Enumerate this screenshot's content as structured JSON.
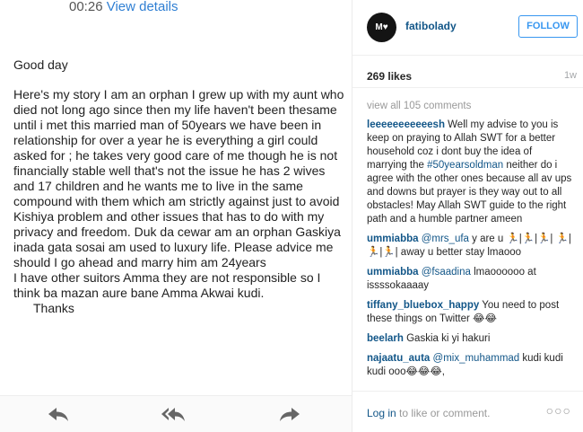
{
  "email": {
    "time": "00:26",
    "view_details": "View details",
    "greeting": "Good day",
    "body": "Here's my story I am an orphan I grew up with my aunt who died not long ago since then my life haven't been thesame until i met this married man of 50years we have been in relationship for over a year he is everything a girl could asked for ; he takes very good care of me though he is not financially stable well that's not the issue he has 2 wives and 17 children and he wants me to live in the same compound with them which am strictly against just to avoid Kishiya problem and other issues that has to do with my privacy and freedom. Duk da cewar am an orphan Gaskiya inada gata sosai am used to luxury life. Please advice me should I go ahead and marry him am 24years",
    "body2": "I have other suitors Amma they are not responsible so I think ba mazan aure bane Amma Akwai kudi.",
    "signoff": "Thanks",
    "footer_icons": [
      "reply-icon",
      "reply-all-icon",
      "forward-icon"
    ]
  },
  "instagram": {
    "avatar_text": "M♥",
    "username": "fatibolady",
    "follow_label": "FOLLOW",
    "likes": "269 likes",
    "age": "1w",
    "view_all": "view all 105 comments",
    "comments": [
      {
        "user": "leeeeeeeeeeesh",
        "pre": " Well my advise to you is keep on praying to Allah SWT for a better household coz i dont buy the idea of marrying the ",
        "link": "#50yearsoldman",
        "post": " neither do i agree with the other ones because all av ups and downs but prayer is they way out to all obstacles! May Allah SWT guide to the right path and a humble partner ameen"
      },
      {
        "user": "ummiabba",
        "pre": " ",
        "link": "@mrs_ufa",
        "post": " y are u 🏃|🏃|🏃| 🏃|🏃|🏃| away u better stay lmaooo"
      },
      {
        "user": "ummiabba",
        "pre": " ",
        "link": "@fsaadina",
        "post": " lmaoooooo at issssokaaaay"
      },
      {
        "user": "tiffany_bluebox_happy",
        "pre": " You need to post these things on Twitter 😂😂",
        "link": "",
        "post": ""
      },
      {
        "user": "beelarh",
        "pre": " Gaskia ki yi hakuri",
        "link": "",
        "post": ""
      },
      {
        "user": "najaatu_auta",
        "pre": " ",
        "link": "@mix_muhammad",
        "post": " kudi kudi kudi ooo😂😂😂,"
      }
    ],
    "login_link": "Log in",
    "login_rest": " to like or comment.",
    "more_label": "○○○"
  }
}
